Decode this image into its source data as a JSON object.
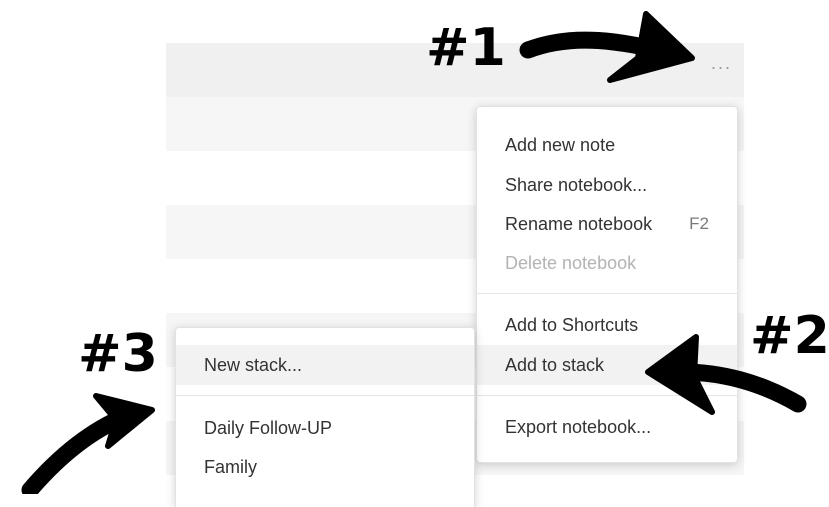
{
  "list": {
    "more_icon": "···"
  },
  "notebook_menu": {
    "items": [
      {
        "label": "Add new note",
        "shortcut": ""
      },
      {
        "label": "Share notebook...",
        "shortcut": ""
      },
      {
        "label": "Rename notebook",
        "shortcut": "F2"
      },
      {
        "label": "Delete notebook",
        "shortcut": "",
        "disabled": true
      },
      {
        "label": "Add to Shortcuts",
        "shortcut": ""
      },
      {
        "label": "Add to stack",
        "shortcut": "",
        "active": true
      },
      {
        "label": "Export notebook...",
        "shortcut": ""
      }
    ]
  },
  "stack_menu": {
    "items": [
      {
        "label": "New stack...",
        "active": true
      },
      {
        "label": "Daily Follow-UP"
      },
      {
        "label": "Family"
      }
    ]
  },
  "annotations": {
    "one": "#1",
    "two": "#2",
    "three": "#3"
  },
  "colors": {
    "row_shaded": "#f6f6f6",
    "menu_hover": "#f2f2f2",
    "disabled_text": "#b3b3b3",
    "annotation": "#000000"
  }
}
